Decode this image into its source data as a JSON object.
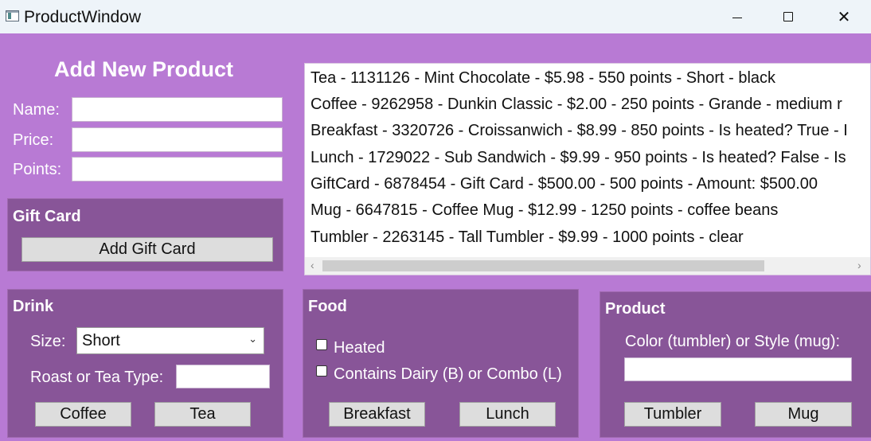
{
  "window": {
    "title": "ProductWindow"
  },
  "add_product": {
    "heading": "Add New Product",
    "name_label": "Name:",
    "price_label": "Price:",
    "points_label": "Points:",
    "name_value": "",
    "price_value": "",
    "points_value": ""
  },
  "gift_card": {
    "heading": "Gift Card",
    "button": "Add Gift Card"
  },
  "products": [
    "Tea - 1131126 - Mint Chocolate - $5.98 - 550 points - Short - black",
    "Coffee - 9262958 - Dunkin Classic - $2.00 - 250 points - Grande - medium r",
    "Breakfast - 3320726 - Croissanwich - $8.99 - 850 points - Is heated? True - I",
    "Lunch - 1729022 - Sub Sandwich - $9.99 - 950 points - Is heated? False - Is",
    "GiftCard - 6878454 - Gift Card - $500.00 - 500 points - Amount: $500.00",
    "Mug - 6647815 - Coffee Mug - $12.99 - 1250 points - coffee beans",
    "Tumbler - 2263145 - Tall Tumbler - $9.99 - 1000 points - clear"
  ],
  "drink": {
    "heading": "Drink",
    "size_label": "Size:",
    "size_value": "Short",
    "roast_label": "Roast or Tea Type:",
    "roast_value": "",
    "coffee_button": "Coffee",
    "tea_button": "Tea"
  },
  "food": {
    "heading": "Food",
    "heated_label": "Heated",
    "dairy_label": "Contains Dairy (B) or Combo (L)",
    "breakfast_button": "Breakfast",
    "lunch_button": "Lunch"
  },
  "product": {
    "heading": "Product",
    "color_label": "Color (tumbler) or Style (mug):",
    "color_value": "",
    "tumbler_button": "Tumbler",
    "mug_button": "Mug"
  },
  "icons": {
    "scroll_left": "‹",
    "scroll_right": "›",
    "dropdown": "⌄",
    "close": "✕"
  }
}
